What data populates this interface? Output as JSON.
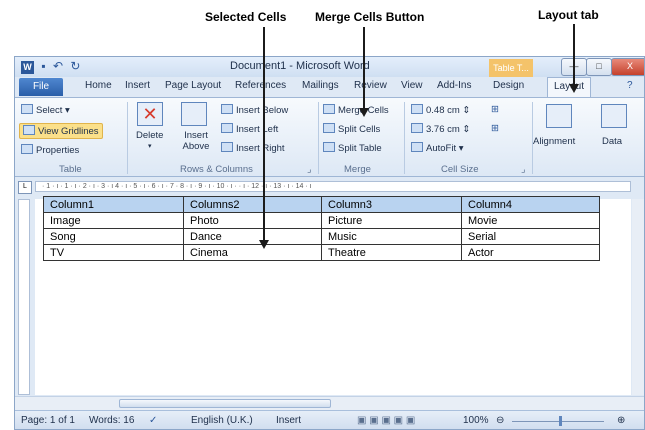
{
  "annotations": {
    "selected_cells": "Selected Cells",
    "merge_button": "Merge Cells Button",
    "layout_tab": "Layout tab"
  },
  "window": {
    "title": "Document1 - Microsoft Word",
    "contextual_tab": "Table T...",
    "minimize": "—",
    "maximize": "□",
    "close": "X"
  },
  "tabs": [
    "File",
    "Home",
    "Insert",
    "Page Layout",
    "References",
    "Mailings",
    "Review",
    "View",
    "Add-Ins",
    "Design",
    "Layout"
  ],
  "ribbon": {
    "table_group": {
      "select": "Select ▾",
      "gridlines": "View Gridlines",
      "properties": "Properties",
      "label": "Table"
    },
    "delete": "Delete",
    "delete_arrow": "▾",
    "insert_above": "Insert Above",
    "insert_below": "Insert Below",
    "insert_left": "Insert Left",
    "insert_right": "Insert Right",
    "rows_label": "Rows & Columns",
    "merge_cells": "Merge Cells",
    "split_cells": "Split Cells",
    "split_table": "Split Table",
    "merge_label": "Merge",
    "height": "0.48 cm",
    "width": "3.76 cm",
    "autofit": "AutoFit ▾",
    "cellsize_label": "Cell Size",
    "alignment": "Alignment",
    "data": "Data"
  },
  "ruler_text": "· 1 · ı · 1 · ı · 2 · ı · 3 · ı   4 · ı · 5 · ı · 6 · ı · 7   · 8 · ı · 9 · ı · 10 · ı ·   · ı · 12 · ı · 13 · ı · 14 · ı",
  "table": {
    "rows": [
      [
        "Column1",
        "Columns2",
        "Column3",
        "Column4"
      ],
      [
        "Image",
        "Photo",
        "Picture",
        "Movie"
      ],
      [
        "Song",
        "Dance",
        "Music",
        "Serial"
      ],
      [
        "TV",
        "Cinema",
        "Theatre",
        "Actor"
      ]
    ]
  },
  "status": {
    "page": "Page: 1 of 1",
    "words": "Words: 16",
    "language": "English (U.K.)",
    "mode": "Insert",
    "zoom": "100%"
  }
}
